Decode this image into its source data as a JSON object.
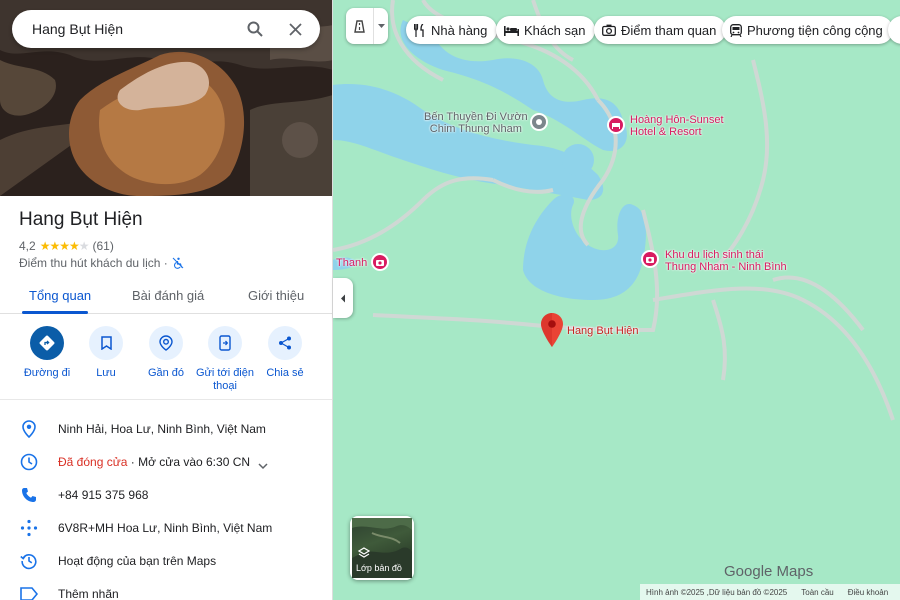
{
  "search": {
    "value": "Hang Bụt Hiện"
  },
  "place": {
    "title": "Hang Bụt Hiện",
    "rating": "4,2",
    "stars_filled": 4,
    "review_count": "(61)",
    "category": "Điểm thu hút khách du lịch ·"
  },
  "tabs": [
    {
      "label": "Tổng quan",
      "active": true
    },
    {
      "label": "Bài đánh giá",
      "active": false
    },
    {
      "label": "Giới thiệu",
      "active": false
    }
  ],
  "actions": [
    {
      "label": "Đường đi",
      "icon": "directions-icon"
    },
    {
      "label": "Lưu",
      "icon": "bookmark-icon"
    },
    {
      "label": "Gần đó",
      "icon": "nearby-icon"
    },
    {
      "label": "Gửi tới điện thoại",
      "icon": "send-to-phone-icon"
    },
    {
      "label": "Chia sẻ",
      "icon": "share-icon"
    }
  ],
  "info": {
    "address": "Ninh Hải, Hoa Lư, Ninh Bình, Việt Nam",
    "hours_status": "Đã đóng cửa",
    "hours_next": " · Mở cửa vào 6:30 CN",
    "phone": "+84 915 375 968",
    "plus_code": "6V8R+MH Hoa Lư, Ninh Bình, Việt Nam",
    "activity": "Hoạt động của bạn trên Maps",
    "label": "Thêm nhãn"
  },
  "chips": [
    {
      "label": "Nhà hàng",
      "icon": "restaurant-icon"
    },
    {
      "label": "Khách sạn",
      "icon": "hotel-icon"
    },
    {
      "label": "Điểm tham quan",
      "icon": "camera-icon"
    },
    {
      "label": "Phương tiện công cộng",
      "icon": "transit-icon"
    }
  ],
  "map_labels": {
    "boat_1": "Bến Thuyền Đi Vườn",
    "boat_2": "Chim Thung Nham",
    "hotel_1": "Hoàng Hôn-Sunset",
    "hotel_2": "Hotel & Resort",
    "eco_1": "Khu du lịch sinh thái",
    "eco_2": "Thung Nham - Ninh Bình",
    "thanh": "Thanh",
    "pin": "Hang Bụt Hiện"
  },
  "layers_label": "Lớp bản đồ",
  "logo": "Google Maps",
  "footer": {
    "imagery": "Hình ảnh ©2025 ,Dữ liệu bản đồ ©2025",
    "global": "Toàn cầu",
    "terms": "Điều khoản"
  },
  "colors": {
    "accent": "#0b57d0",
    "closed": "#d93025",
    "star": "#fbbc04",
    "map_land": "#a6e8c6",
    "map_water": "#8fd3ea",
    "poi_pink": "#d81b60"
  }
}
